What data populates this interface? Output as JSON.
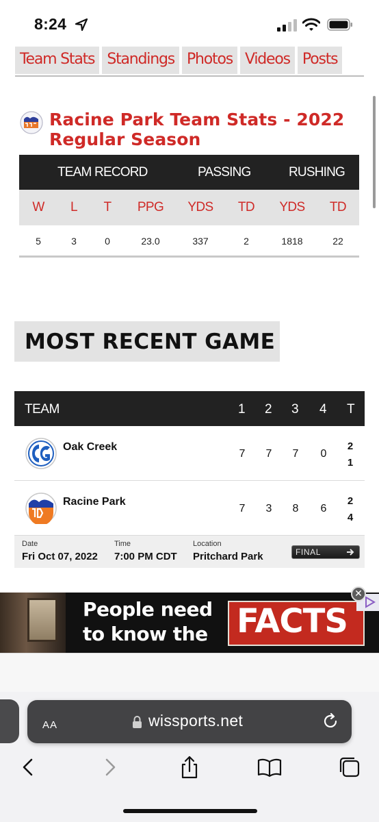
{
  "status": {
    "time": "8:24"
  },
  "tabs": [
    "Team Stats",
    "Standings",
    "Photos",
    "Videos",
    "Posts"
  ],
  "team_stats": {
    "title": "Racine Park Team Stats - 2022 Regular Season",
    "groups": {
      "record": "TEAM RECORD",
      "passing": "PASSING",
      "rushing": "RUSHING"
    },
    "columns": [
      "W",
      "L",
      "T",
      "PPG",
      "YDS",
      "TD",
      "YDS",
      "TD"
    ],
    "values": [
      "5",
      "3",
      "0",
      "23.0",
      "337",
      "2",
      "1818",
      "22"
    ]
  },
  "recent_game": {
    "heading": "MOST RECENT GAME",
    "header": {
      "team": "TEAM",
      "q1": "1",
      "q2": "2",
      "q3": "3",
      "q4": "4",
      "total": "T"
    },
    "teams": [
      {
        "name": "Oak Creek",
        "q1": "7",
        "q2": "7",
        "q3": "7",
        "q4": "0",
        "total": "21"
      },
      {
        "name": "Racine Park",
        "q1": "7",
        "q2": "3",
        "q3": "8",
        "q4": "6",
        "total": "24"
      }
    ],
    "footer": {
      "date_label": "Date",
      "date": "Fri Oct 07, 2022",
      "time_label": "Time",
      "time": "7:00 PM CDT",
      "location_label": "Location",
      "location": "Pritchard Park",
      "status": "FINAL"
    }
  },
  "ad": {
    "line1": "People need",
    "line2": "to know the",
    "highlight": "FACTS",
    "close": "✕"
  },
  "browser": {
    "text_size": "AA",
    "url": "wissports.net"
  },
  "colors": {
    "accent": "#cf2a27",
    "header_dark": "#222222",
    "tab_bg": "#e3e3e3"
  },
  "icons": [
    "location-arrow-icon",
    "signal-icon",
    "wifi-icon",
    "battery-icon",
    "lock-icon",
    "reload-icon",
    "back-icon",
    "forward-icon",
    "share-icon",
    "bookmarks-icon",
    "tabs-icon",
    "arrow-right-icon"
  ]
}
